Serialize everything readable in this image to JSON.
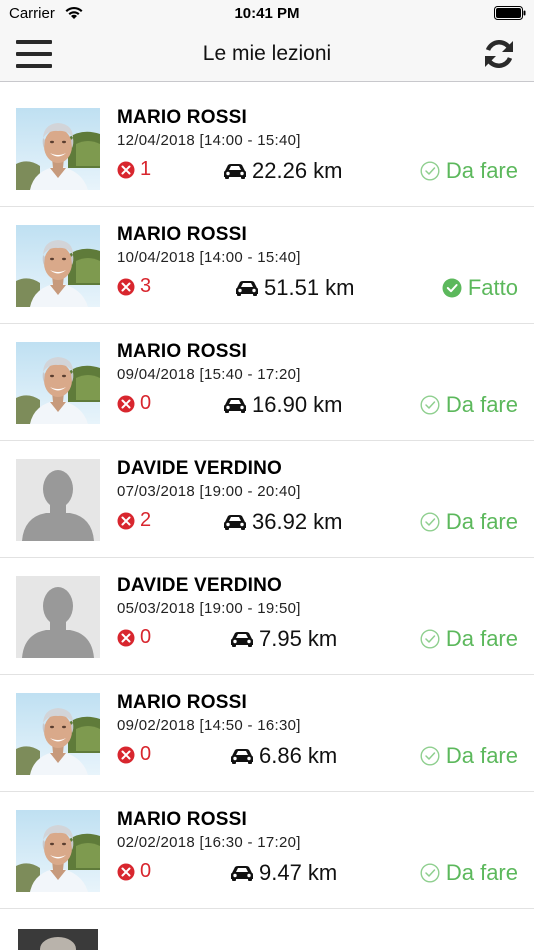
{
  "status_bar": {
    "carrier": "Carrier",
    "time": "10:41 PM"
  },
  "nav": {
    "title": "Le mie lezioni"
  },
  "colors": {
    "error": "#d8262e",
    "done": "#5cb85c",
    "nav_bg": "#f7f7f7"
  },
  "lessons": [
    {
      "name": "MARIO ROSSI",
      "date": "12/04/2018 [14:00 - 15:40]",
      "errors": "1",
      "distance": "22.26 km",
      "status": "Da fare",
      "done": false,
      "avatar": "photo"
    },
    {
      "name": "MARIO ROSSI",
      "date": "10/04/2018 [14:00 - 15:40]",
      "errors": "3",
      "distance": "51.51 km",
      "status": "Fatto",
      "done": true,
      "avatar": "photo"
    },
    {
      "name": "MARIO ROSSI",
      "date": "09/04/2018 [15:40 - 17:20]",
      "errors": "0",
      "distance": "16.90 km",
      "status": "Da fare",
      "done": false,
      "avatar": "photo"
    },
    {
      "name": "DAVIDE VERDINO",
      "date": "07/03/2018 [19:00 - 20:40]",
      "errors": "2",
      "distance": "36.92 km",
      "status": "Da fare",
      "done": false,
      "avatar": "placeholder"
    },
    {
      "name": "DAVIDE VERDINO",
      "date": "05/03/2018 [19:00 - 19:50]",
      "errors": "0",
      "distance": "7.95 km",
      "status": "Da fare",
      "done": false,
      "avatar": "placeholder"
    },
    {
      "name": "MARIO ROSSI",
      "date": "09/02/2018 [14:50 - 16:30]",
      "errors": "0",
      "distance": "6.86 km",
      "status": "Da fare",
      "done": false,
      "avatar": "photo"
    },
    {
      "name": "MARIO ROSSI",
      "date": "02/02/2018 [16:30 - 17:20]",
      "errors": "0",
      "distance": "9.47 km",
      "status": "Da fare",
      "done": false,
      "avatar": "photo"
    }
  ]
}
